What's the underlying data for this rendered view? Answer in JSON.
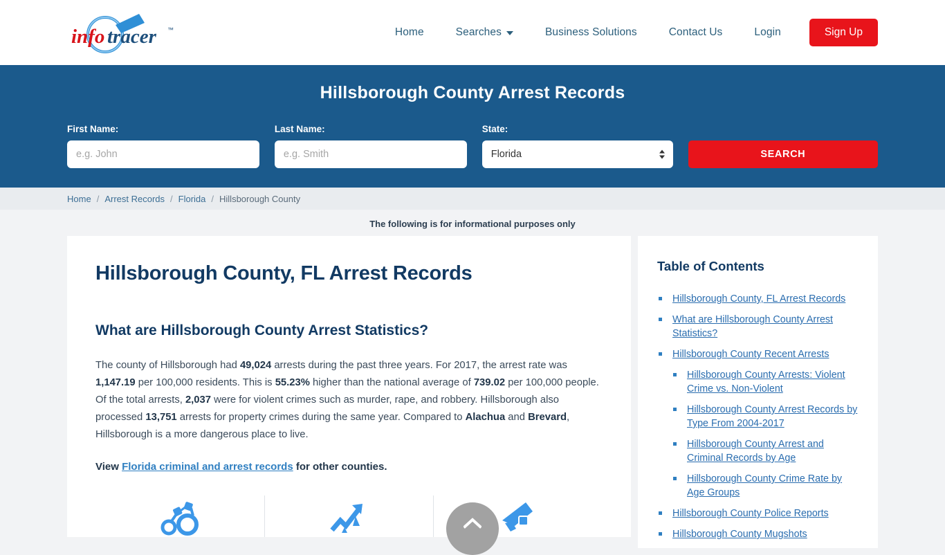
{
  "header": {
    "logo_alt": "infotracer",
    "nav": [
      {
        "label": "Home",
        "has_caret": false
      },
      {
        "label": "Searches",
        "has_caret": true
      },
      {
        "label": "Business Solutions",
        "has_caret": false
      },
      {
        "label": "Contact Us",
        "has_caret": false
      },
      {
        "label": "Login",
        "has_caret": false
      }
    ],
    "signup_label": "Sign Up"
  },
  "banner": {
    "title": "Hillsborough County Arrest Records",
    "first_name_label": "First Name:",
    "first_name_placeholder": "e.g. John",
    "first_name_value": "",
    "last_name_label": "Last Name:",
    "last_name_placeholder": "e.g. Smith",
    "last_name_value": "",
    "state_label": "State:",
    "state_selected": "Florida",
    "search_button": "SEARCH",
    "accent_blue": "#1b5a8c",
    "accent_red": "#e8141b"
  },
  "breadcrumb": {
    "items": [
      "Home",
      "Arrest Records",
      "Florida"
    ],
    "current": "Hillsborough County",
    "separator": "/"
  },
  "notice": "The following is for informational purposes only",
  "main": {
    "h1": "Hillsborough County, FL Arrest Records",
    "h2": "What are Hillsborough County Arrest Statistics?",
    "paragraph": {
      "p1": "The county of Hillsborough had ",
      "b1": "49,024",
      "p2": " arrests during the past three years. For 2017, the arrest rate was ",
      "b2": "1,147.19",
      "p3": " per 100,000 residents. This is ",
      "b3": "55.23%",
      "p4": " higher than the national average of ",
      "b4": "739.02",
      "p5": " per 100,000 people. Of the total arrests, ",
      "b5": "2,037",
      "p6": " were for violent crimes such as murder, rape, and robbery. Hillsborough also processed ",
      "b6": "13,751",
      "p7": " arrests for property crimes during the same year. Compared to ",
      "b7": "Alachua",
      "p8": " and ",
      "b8": "Brevard",
      "p9": ", Hillsborough is a more dangerous place to live."
    },
    "view_prefix": "View ",
    "view_link": "Florida criminal and arrest records",
    "view_suffix": " for other counties.",
    "icons": [
      "handcuffs-icon",
      "trend-chart-icon",
      "gun-icon"
    ]
  },
  "toc": {
    "title": "Table of Contents",
    "items": [
      {
        "label": "Hillsborough County, FL Arrest Records",
        "children": []
      },
      {
        "label": "What are Hillsborough County Arrest Statistics?",
        "children": []
      },
      {
        "label": "Hillsborough County Recent Arrests",
        "children": [
          {
            "label": "Hillsborough County Arrests: Violent Crime vs. Non-Violent"
          },
          {
            "label": "Hillsborough County Arrest Records by Type From 2004-2017"
          },
          {
            "label": "Hillsborough County Arrest and Criminal Records by Age"
          },
          {
            "label": "Hillsborough County Crime Rate by Age Groups"
          }
        ]
      },
      {
        "label": "Hillsborough County Police Reports",
        "children": []
      },
      {
        "label": "Hillsborough County Mugshots",
        "children": []
      }
    ]
  },
  "scroll_top": {
    "icon": "chevron-up-icon"
  }
}
